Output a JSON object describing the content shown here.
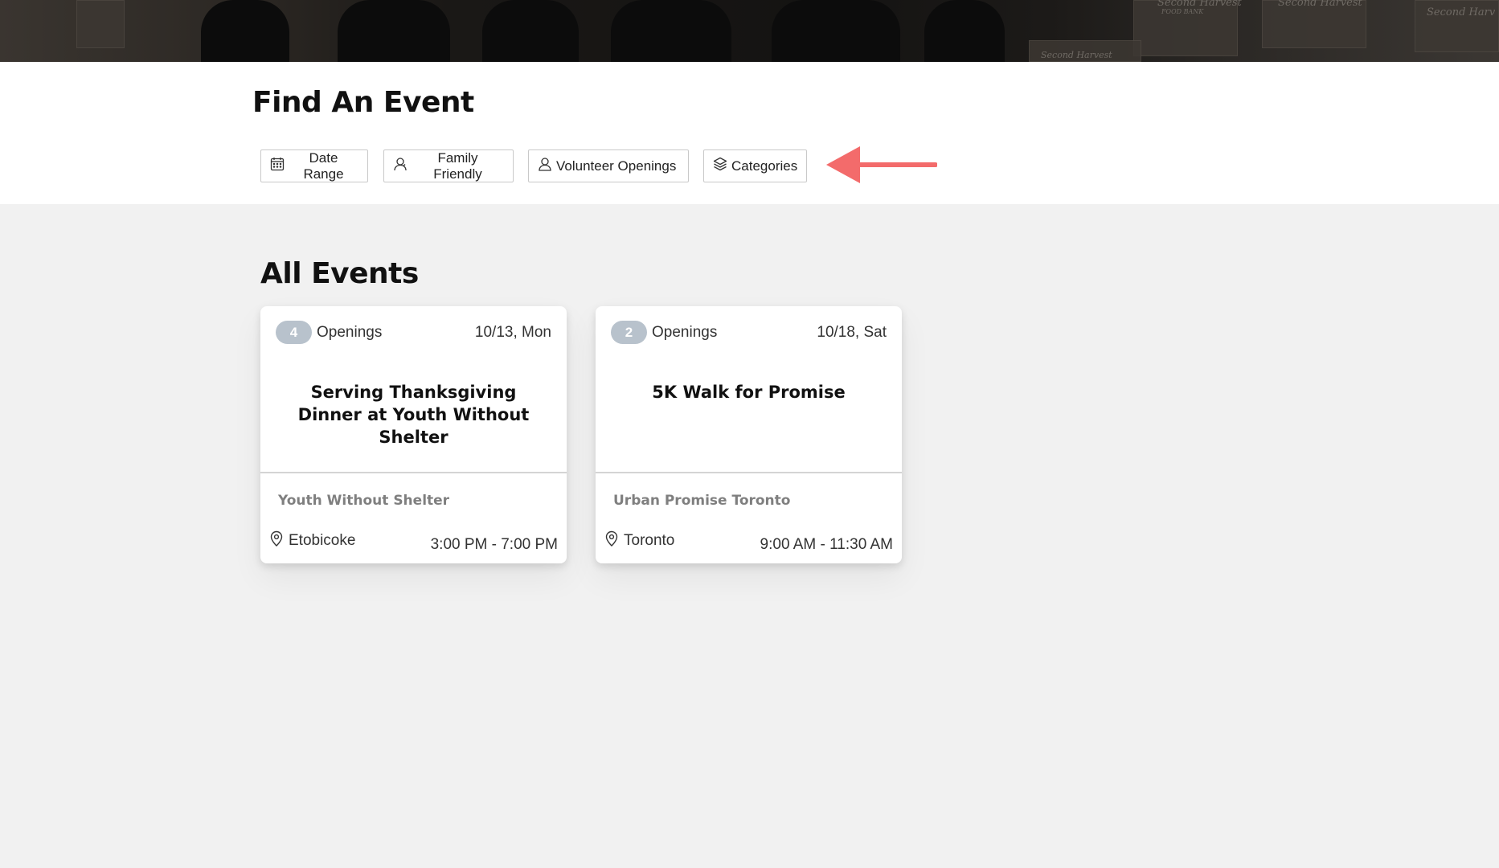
{
  "hero": {
    "banner_texts": [
      "Second Harvest",
      "FOOD BANK",
      "Second Harvest",
      "Second Harv",
      "Second Harvest"
    ]
  },
  "header": {
    "title": "Find An Event"
  },
  "filters": [
    {
      "label": "Date Range",
      "icon": "calendar-icon"
    },
    {
      "label": "Family Friendly",
      "icon": "user-icon"
    },
    {
      "label": "Volunteer Openings",
      "icon": "user-icon"
    },
    {
      "label": "Categories",
      "icon": "layers-icon"
    }
  ],
  "annotation": {
    "arrow_color": "#f36b6b"
  },
  "events_section": {
    "title": "All Events"
  },
  "events": [
    {
      "openings_count": "4",
      "openings_label": "Openings",
      "date": "10/13, Mon",
      "title": "Serving Thanksgiving Dinner at Youth Without Shelter",
      "organization": "Youth Without Shelter",
      "location": "Etobicoke",
      "time": "3:00 PM - 7:00 PM"
    },
    {
      "openings_count": "2",
      "openings_label": "Openings",
      "date": "10/18, Sat",
      "title": "5K Walk for Promise",
      "organization": "Urban Promise Toronto",
      "location": "Toronto",
      "time": "9:00 AM - 11:30 AM"
    }
  ],
  "colors": {
    "page_background": "#f1f1f1",
    "badge": "#b8c2cc",
    "org_text": "#7f7f7f"
  }
}
